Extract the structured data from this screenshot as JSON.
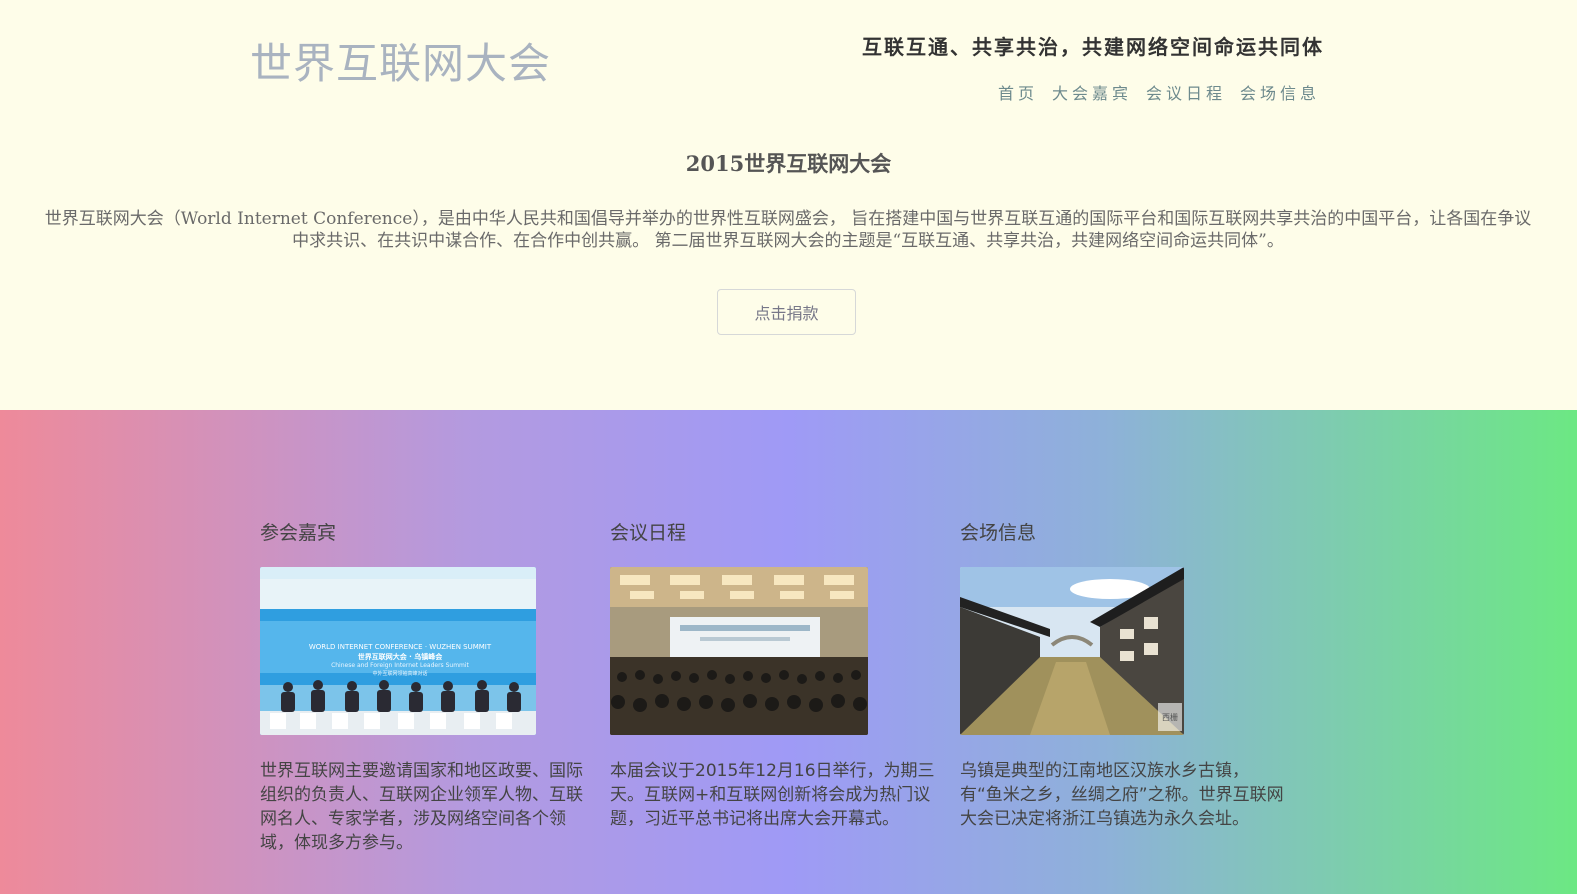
{
  "header": {
    "site_title": "世界互联网大会",
    "slogan": "互联互通、共享共治，共建网络空间命运共同体",
    "nav": [
      {
        "label": "首页"
      },
      {
        "label": "大会嘉宾"
      },
      {
        "label": "会议日程"
      },
      {
        "label": "会场信息"
      }
    ]
  },
  "intro": {
    "title": "2015世界互联网大会",
    "text": "世界互联网大会（World Internet Conference），是由中华人民共和国倡导并举办的世界性互联网盛会， 旨在搭建中国与世界互联互通的国际平台和国际互联网共享共治的中国平台，让各国在争议中求共识、在共识中谋合作、在合作中创共赢。 第二届世界互联网大会的主题是“互联互通、共享共治，共建网络空间命运共同体”。",
    "donate_button": "点击捐款"
  },
  "cards": [
    {
      "title": "参会嘉宾",
      "text": "世界互联网主要邀请国家和地区政要、国际组织的负责人、互联网企业领军人物、互联网名人、专家学者，涉及网络空间各个领域，体现多方参与。",
      "image": {
        "banner_line1": "WORLD INTERNET CONFERENCE · WUZHEN SUMMIT",
        "banner_line2": "世界互联网大会 · 乌镇峰会",
        "banner_line3": "Chinese and Foreign Internet Leaders Summit",
        "banner_line4": "中外互联网领袖高峰对话"
      }
    },
    {
      "title": "会议日程",
      "text": "本届会议于2015年12月16日举行，为期三天。互联网+和互联网创新将会成为热门议题，习近平总书记将出席大会开幕式。"
    },
    {
      "title": "会场信息",
      "text": "乌镇是典型的江南地区汉族水乡古镇，有“鱼米之乡，丝绸之府”之称。世界互联网大会已决定将浙江乌镇选为永久会址。",
      "image": {
        "seal": "西栅"
      }
    }
  ]
}
